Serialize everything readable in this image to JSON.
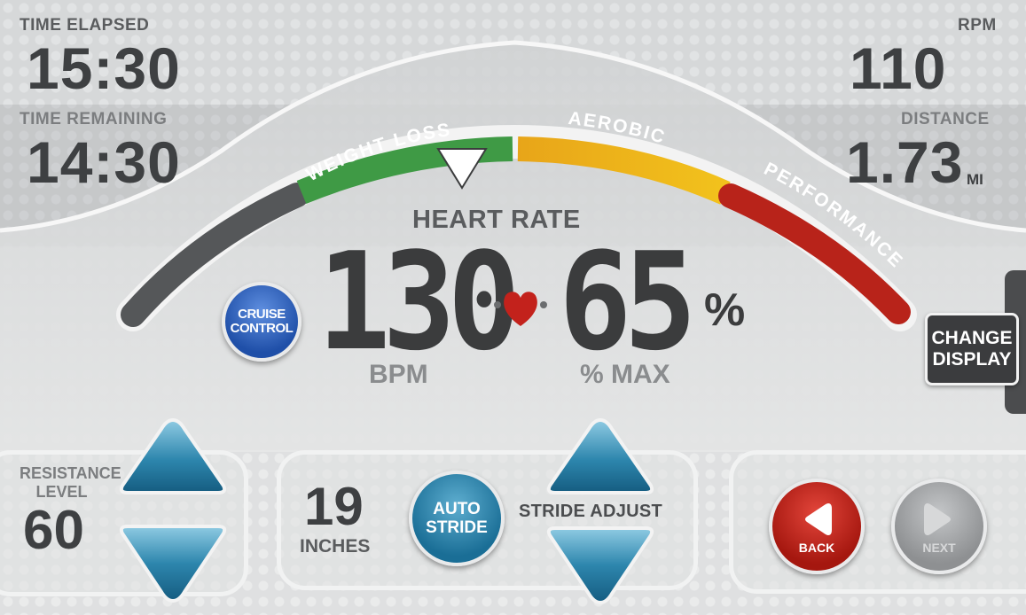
{
  "stats": {
    "time_elapsed_label": "TIME ELAPSED",
    "time_elapsed_value": "15:30",
    "time_remaining_label": "TIME REMAINING",
    "time_remaining_value": "14:30",
    "rpm_label": "RPM",
    "rpm_value": "110",
    "distance_label": "DISTANCE",
    "distance_value": "1.73",
    "distance_unit": "MI"
  },
  "zones": {
    "weight_loss": "WEIGHT LOSS",
    "aerobic": "AEROBIC",
    "performance": "PERFORMANCE"
  },
  "heart": {
    "title": "HEART RATE",
    "bpm_value": "130",
    "bpm_label": "BPM",
    "percent_value": "65",
    "percent_sign": "%",
    "percent_label": "% MAX"
  },
  "buttons": {
    "cruise_line1": "CRUISE",
    "cruise_line2": "CONTROL",
    "change_line1": "CHANGE",
    "change_line2": "DISPLAY",
    "auto_line1": "AUTO",
    "auto_line2": "STRIDE",
    "back": "BACK",
    "next": "NEXT"
  },
  "resistance": {
    "label_line1": "RESISTANCE",
    "label_line2": "LEVEL",
    "value": "60"
  },
  "stride": {
    "value": "19",
    "unit": "INCHES",
    "adjust_label": "STRIDE ADJUST"
  },
  "colors": {
    "zone_gray": "#555759",
    "zone_green": "#3f9a45",
    "zone_yellow": "#e8a519",
    "zone_red": "#b8231a",
    "cruise_blue": "#1f4fa8",
    "teal": "#1a6e96",
    "back_red": "#a5170f"
  },
  "icons": {
    "heart": "heart-icon",
    "zone_marker": "triangle-marker-icon",
    "back": "play-left-icon",
    "next": "play-right-icon",
    "up": "triangle-up-icon",
    "down": "triangle-down-icon"
  }
}
